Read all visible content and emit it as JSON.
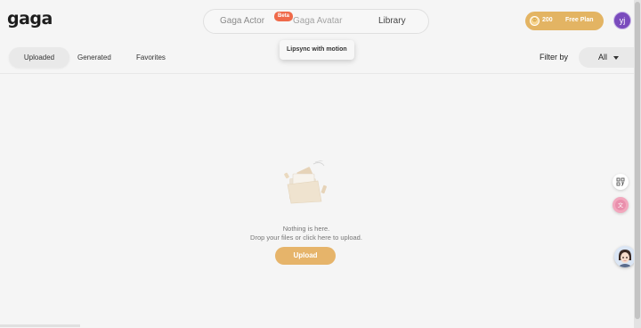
{
  "app": {
    "logo": "gaga"
  },
  "topnav": {
    "items": [
      {
        "label": "Gaga Actor",
        "badge": "Beta"
      },
      {
        "label": "Gaga Avatar"
      },
      {
        "label": "Library",
        "active": true
      }
    ],
    "tooltip": "Lipsync with motion"
  },
  "account": {
    "credits": "200",
    "plan": "Free Plan",
    "user_initials": "yj"
  },
  "library": {
    "tabs": [
      {
        "label": "Uploaded",
        "active": true
      },
      {
        "label": "Generated"
      },
      {
        "label": "Favorites"
      }
    ],
    "filter": {
      "label": "Filter by",
      "value": "All"
    }
  },
  "empty_state": {
    "title": "Nothing is here.",
    "subtitle": "Drop your files or click here to upload.",
    "upload_label": "Upload"
  },
  "colors": {
    "accent": "#e6b46a",
    "badge": "#ef6a4a",
    "avatar": "#7a4bbd",
    "background": "#f5f5f5"
  },
  "icons": {
    "empty_illustration": "folder-with-papers-icon",
    "side_tool_1": "qr-code-icon",
    "side_tool_2": "translate-icon",
    "assistant": "assistant-avatar-icon",
    "coin": "coin-icon",
    "filter_caret": "caret-down-icon"
  }
}
